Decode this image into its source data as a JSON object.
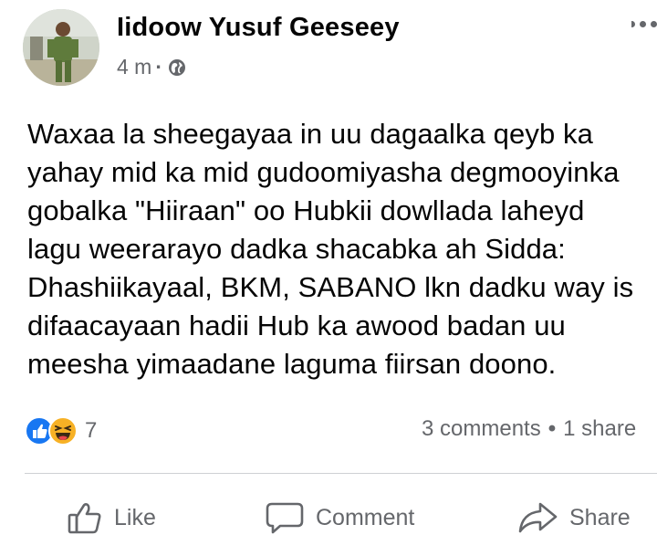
{
  "post": {
    "author": "Iidoow Yusuf Geeseey",
    "time": "4 m",
    "separator": "·",
    "audience_icon": "globe-icon",
    "text": "Waxaa la sheegayaa in uu dagaalka qeyb ka\nyahay mid ka mid gudoomiyasha degmooyinka\ngobalka \"Hiiraan\" oo Hubkii dowllada laheyd\nlagu weerarayo dadka shacabka ah Sidda:\nDhashiikayaal, BKM, SABANO lkn dadku way is\ndifaacayaan hadii Hub ka awood badan uu\nmeesha yimaadane laguma fiirsan doono."
  },
  "reactions": {
    "icons": [
      "like-icon",
      "haha-icon"
    ],
    "count": "7"
  },
  "stats": {
    "comments": "3 comments",
    "separator": "•",
    "shares": "1 share"
  },
  "actions": {
    "like": "Like",
    "comment": "Comment",
    "share": "Share"
  },
  "colors": {
    "accent": "#1877f2",
    "haha": "#f7b125",
    "secondary_text": "#65676b",
    "divider": "#ced0d4"
  }
}
